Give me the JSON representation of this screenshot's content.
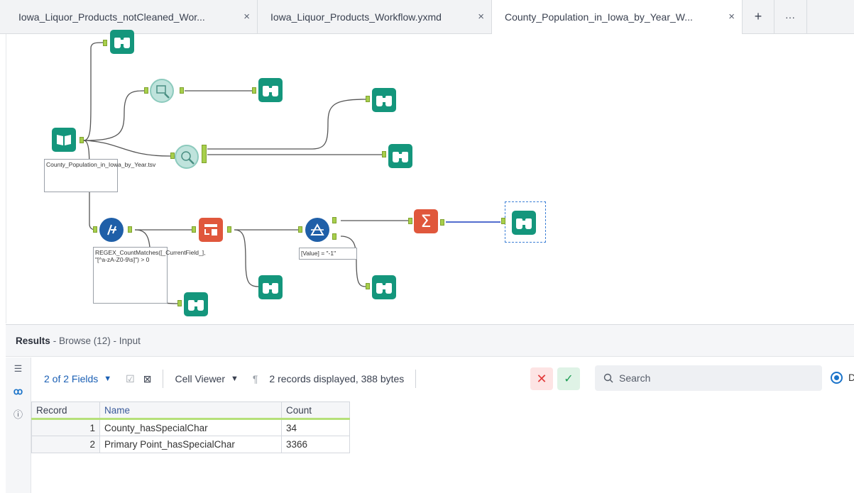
{
  "tabs": [
    {
      "label": "Iowa_Liquor_Products_notCleaned_Wor...",
      "active": false
    },
    {
      "label": "Iowa_Liquor_Products_Workflow.yxmd",
      "active": false
    },
    {
      "label": "County_Population_in_Iowa_by_Year_W...",
      "active": true
    }
  ],
  "tab_close_glyph": "×",
  "tab_add_glyph": "+",
  "tab_more_glyph": "···",
  "canvas": {
    "input_label": "County_Population_in_Iowa_by_Year.tsv",
    "formula_label": "REGEX_CountMatches([_CurrentField_], \"[^a-zA-Z0-9\\s]\") > 0",
    "filter_label": "[Value] = \"-1\"",
    "summarize_glyph": "Σ"
  },
  "results": {
    "title": "Results",
    "subtitle": "- Browse (12) - Input"
  },
  "toolbar": {
    "fields": "2 of 2 Fields",
    "cell_viewer": "Cell Viewer",
    "records_info": "2 records displayed, 388 bytes",
    "search_placeholder": "Search",
    "radio_partial": "D"
  },
  "table": {
    "headers": [
      "Record",
      "Name",
      "Count"
    ],
    "rows": [
      {
        "record": "1",
        "name": "County_hasSpecialChar",
        "count": "34"
      },
      {
        "record": "2",
        "name": "Primary Point_hasSpecialChar",
        "count": "3366"
      }
    ]
  },
  "colors": {
    "browse": "#14967c",
    "formula": "#1f5fa8",
    "select": "#e0573c",
    "anchor": "#a7cf4b",
    "header_underline": "#b6e07a"
  }
}
